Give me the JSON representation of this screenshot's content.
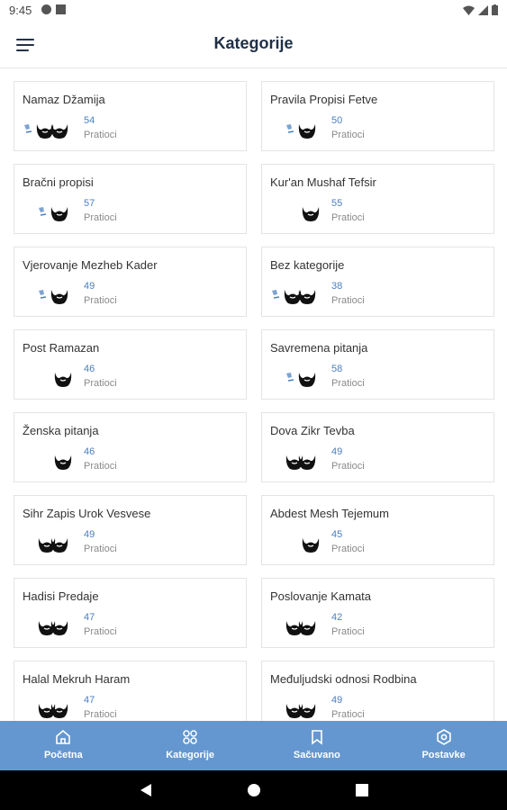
{
  "status_bar": {
    "time": "9:45"
  },
  "header": {
    "title": "Kategorije"
  },
  "categories": [
    {
      "title": "Namaz Džamija",
      "count": "54",
      "followers_label": "Pratioci",
      "avatars": [
        "default",
        "beard",
        "beard"
      ]
    },
    {
      "title": "Pravila Propisi Fetve",
      "count": "50",
      "followers_label": "Pratioci",
      "avatars": [
        "default",
        "beard"
      ]
    },
    {
      "title": "Bračni propisi",
      "count": "57",
      "followers_label": "Pratioci",
      "avatars": [
        "default",
        "beard"
      ]
    },
    {
      "title": "Kur'an Mushaf Tefsir",
      "count": "55",
      "followers_label": "Pratioci",
      "avatars": [
        "beard"
      ]
    },
    {
      "title": "Vjerovanje Mezheb Kader",
      "count": "49",
      "followers_label": "Pratioci",
      "avatars": [
        "default",
        "beard"
      ]
    },
    {
      "title": "Bez kategorije",
      "count": "38",
      "followers_label": "Pratioci",
      "avatars": [
        "default",
        "beard",
        "beard"
      ]
    },
    {
      "title": "Post Ramazan",
      "count": "46",
      "followers_label": "Pratioci",
      "avatars": [
        "beard"
      ]
    },
    {
      "title": "Savremena pitanja",
      "count": "58",
      "followers_label": "Pratioci",
      "avatars": [
        "default",
        "beard"
      ]
    },
    {
      "title": "Ženska pitanja",
      "count": "46",
      "followers_label": "Pratioci",
      "avatars": [
        "beard"
      ]
    },
    {
      "title": "Dova Zikr Tevba",
      "count": "49",
      "followers_label": "Pratioci",
      "avatars": [
        "beard",
        "beard"
      ]
    },
    {
      "title": "Sihr Zapis Urok Vesvese",
      "count": "49",
      "followers_label": "Pratioci",
      "avatars": [
        "beard",
        "beard"
      ]
    },
    {
      "title": "Abdest Mesh Tejemum",
      "count": "45",
      "followers_label": "Pratioci",
      "avatars": [
        "beard"
      ]
    },
    {
      "title": "Hadisi Predaje",
      "count": "47",
      "followers_label": "Pratioci",
      "avatars": [
        "beard",
        "beard"
      ]
    },
    {
      "title": "Poslovanje Kamata",
      "count": "42",
      "followers_label": "Pratioci",
      "avatars": [
        "beard",
        "beard"
      ]
    },
    {
      "title": "Halal Mekruh Haram",
      "count": "47",
      "followers_label": "Pratioci",
      "avatars": [
        "beard",
        "beard"
      ]
    },
    {
      "title": "Međuljudski odnosi Rodbina",
      "count": "49",
      "followers_label": "Pratioci",
      "avatars": [
        "beard",
        "beard"
      ]
    }
  ],
  "bottom_nav": [
    {
      "label": "Početna",
      "icon": "home-icon"
    },
    {
      "label": "Kategorije",
      "icon": "grid-icon"
    },
    {
      "label": "Sačuvano",
      "icon": "bookmark-icon"
    },
    {
      "label": "Postavke",
      "icon": "settings-icon"
    }
  ],
  "colors": {
    "accent": "#6497cf",
    "count": "#4a7fc1",
    "title": "#1f2f45"
  }
}
